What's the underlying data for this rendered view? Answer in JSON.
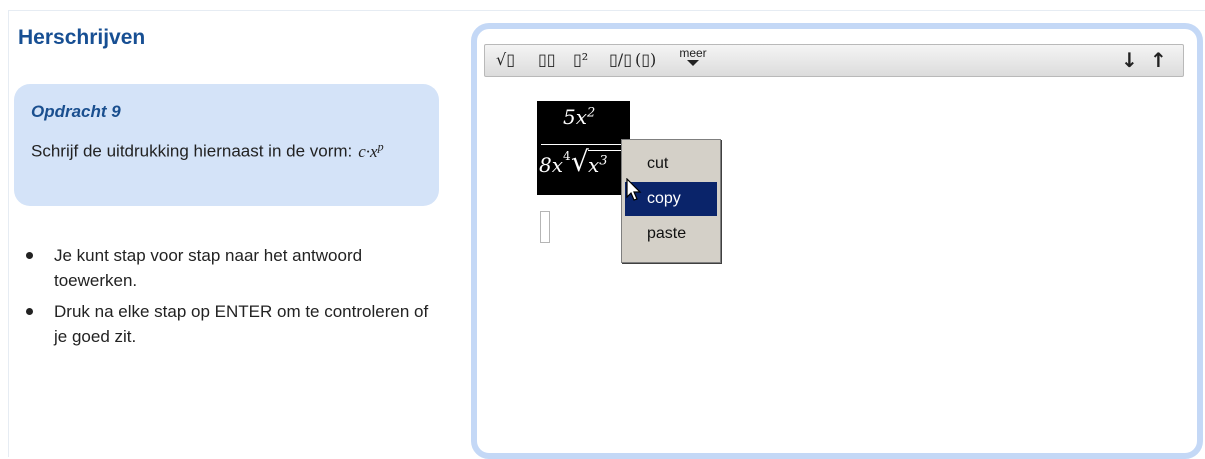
{
  "page": {
    "title": "Herschrijven"
  },
  "task": {
    "title": "Opdracht 9",
    "text": "Schrijf de uitdrukking hiernaast in de vorm:",
    "formula_base": "c·x",
    "formula_exp": "p"
  },
  "bullets": [
    "Je kunt stap voor stap naar het antwoord toewerken.",
    "Druk na elke stap op ENTER om te controleren of je goed zit."
  ],
  "toolbar": {
    "sqrt": "√▯",
    "subscript": "▯▯",
    "power": "▯²",
    "fraction": "▯/▯",
    "parentheses": "(▯)",
    "meer": "meer",
    "down": "↓",
    "up": "↑"
  },
  "expression": {
    "numerator_coef": "5x",
    "numerator_exp": "2",
    "denominator_coef": "8x",
    "root_index": "4",
    "radical": "√",
    "radicand_base": "x",
    "radicand_exp": "3"
  },
  "context_menu": {
    "items": [
      "cut",
      "copy",
      "paste"
    ],
    "selected": "copy"
  },
  "colors": {
    "title": "#174f93",
    "task_bg": "#d4e3f8",
    "panel_border": "#c4d8f6",
    "menu_highlight": "#0a246a"
  }
}
